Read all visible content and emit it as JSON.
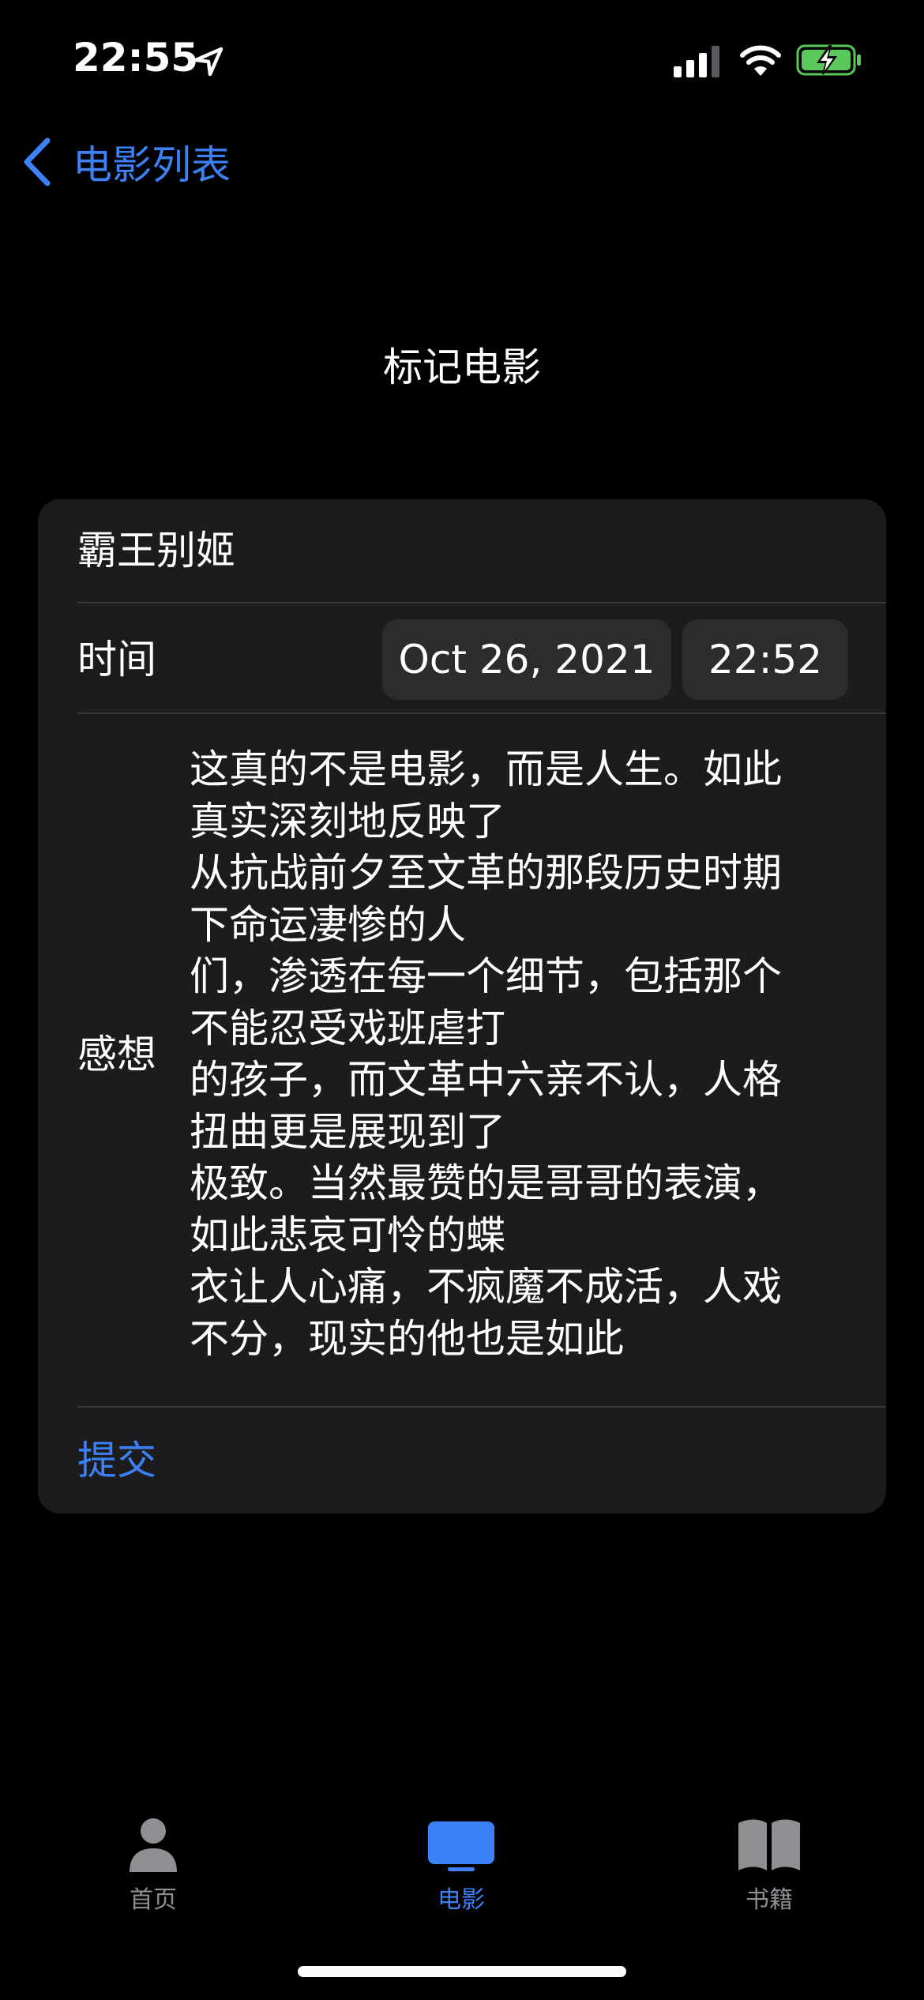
{
  "status_bar": {
    "time": "22:55",
    "icons": [
      "location-icon",
      "signal-icon",
      "wifi-icon",
      "battery-charging-icon"
    ]
  },
  "nav": {
    "back_label": "电影列表",
    "title": "标记电影"
  },
  "form": {
    "movie_title": "霸王别姬",
    "time_label": "时间",
    "date_value": "Oct 26, 2021",
    "time_value": "22:52",
    "thoughts_label": "感想",
    "thoughts_text": "这真的不是电影，而是人生。如此\n真实深刻地反映了\n从抗战前夕至文革的那段历史时期\n下命运凄惨的人\n们，渗透在每一个细节，包括那个\n不能忍受戏班虐打\n的孩子，而文革中六亲不认，人格\n扭曲更是展现到了\n极致。当然最赞的是哥哥的表演，\n如此悲哀可怜的蝶\n衣让人心痛，不疯魔不成活，人戏\n不分，现实的他也是如此",
    "submit_label": "提交"
  },
  "tab_bar": {
    "items": [
      {
        "label": "首页",
        "icon": "person-icon",
        "selected": false
      },
      {
        "label": "电影",
        "icon": "tv-icon",
        "selected": true
      },
      {
        "label": "书籍",
        "icon": "book-icon",
        "selected": false
      }
    ]
  },
  "colors": {
    "accent": "#3c82f6",
    "background": "#000000",
    "card": "#1c1c1e",
    "pill": "#2c2c2e",
    "inactive_tab": "#8e8e93",
    "battery_green": "#5ac85a"
  }
}
